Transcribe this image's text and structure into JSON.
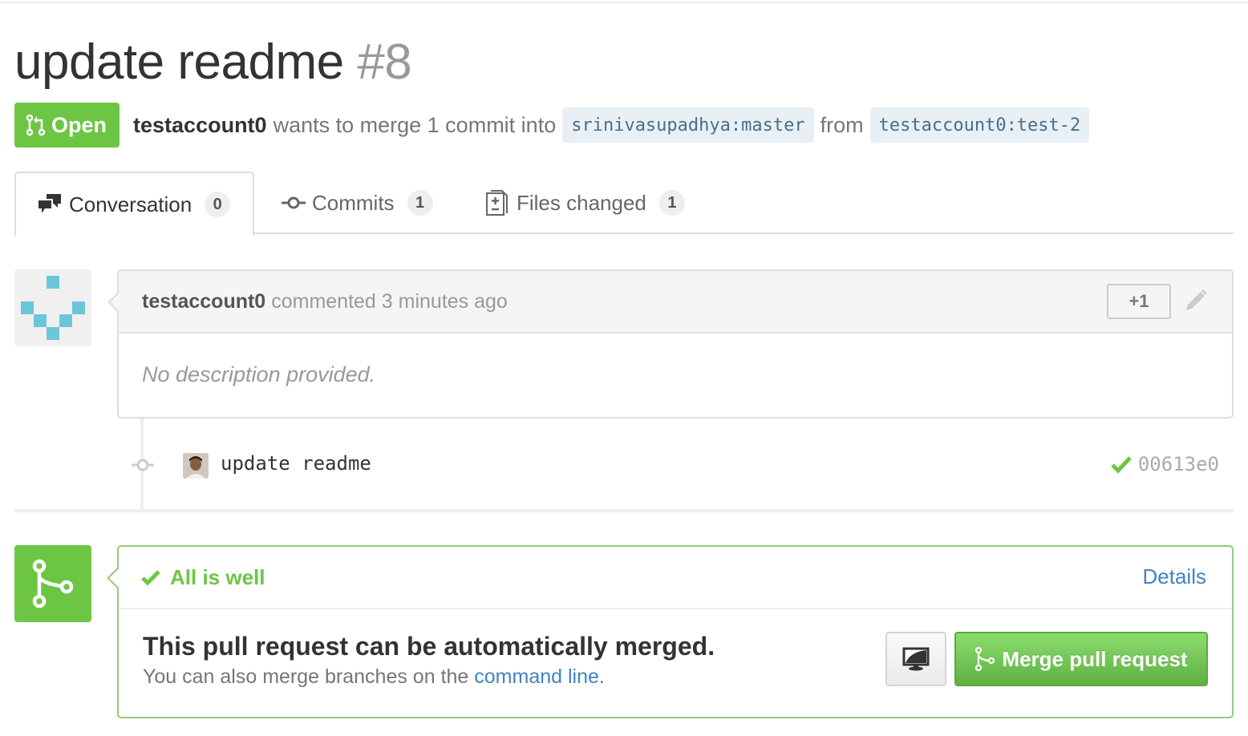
{
  "pr": {
    "title": "update readme",
    "number": "#8",
    "state_label": "Open",
    "author": "testaccount0",
    "merge_text_pre": "wants to merge 1 commit into",
    "base_branch": "srinivasupadhya:master",
    "from_label": "from",
    "head_branch": "testaccount0:test-2"
  },
  "tabs": [
    {
      "label": "Conversation",
      "count": "0",
      "icon": "comment-discussion-icon",
      "selected": true
    },
    {
      "label": "Commits",
      "count": "1",
      "icon": "git-commit-icon",
      "selected": false
    },
    {
      "label": "Files changed",
      "count": "1",
      "icon": "file-diff-icon",
      "selected": false
    }
  ],
  "comment": {
    "author": "testaccount0",
    "action": "commented 3 minutes ago",
    "reaction_label": "+1",
    "body": "No description provided."
  },
  "commit": {
    "message": "update readme",
    "sha": "00613e0",
    "status": "success"
  },
  "merge": {
    "status_label": "All is well",
    "details_label": "Details",
    "title": "This pull request can be automatically merged.",
    "sub_pre": "You can also merge branches on the",
    "sub_link": "command line",
    "sub_post": ".",
    "button_label": "Merge pull request"
  },
  "colors": {
    "green": "#6cc644",
    "link": "#4183c4",
    "identicon": "#6bc6da"
  }
}
